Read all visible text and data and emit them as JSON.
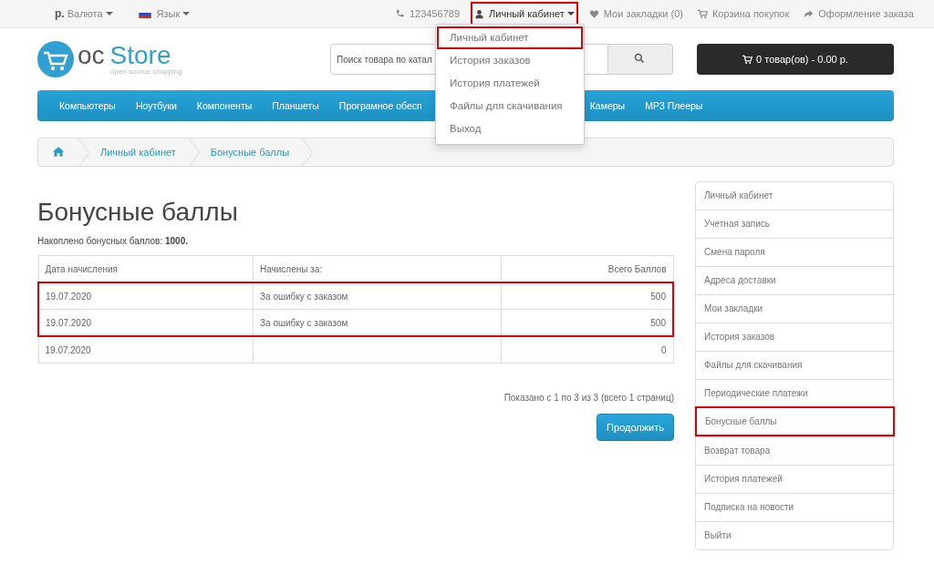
{
  "top_bar": {
    "currency": {
      "symbol": "р.",
      "label": "Валюта"
    },
    "language": {
      "label": "Язык"
    },
    "phone": "123456789",
    "links": [
      {
        "kind": "account",
        "label": "Личный кабинет",
        "highlighted": true
      },
      {
        "kind": "wishlist",
        "label": "Мои закладки (0)",
        "highlighted": false
      },
      {
        "kind": "cart",
        "label": "Корзина покупок",
        "highlighted": false
      },
      {
        "kind": "checkout",
        "label": "Оформление заказа",
        "highlighted": false
      }
    ]
  },
  "account_menu": {
    "items": [
      {
        "label": "Личный кабинет",
        "highlighted": true
      },
      {
        "label": "История заказов",
        "highlighted": false
      },
      {
        "label": "История платежей",
        "highlighted": false
      },
      {
        "label": "Файлы для скачивания",
        "highlighted": false
      },
      {
        "label": "Выход",
        "highlighted": false
      }
    ]
  },
  "logo": {
    "brand_1": "oc",
    "brand_2": "Store",
    "tagline": "open source shopping"
  },
  "search": {
    "placeholder": "Поиск товара по катал"
  },
  "cart_button": "0 товар(ов) - 0.00 р.",
  "nav": [
    "Компьютеры",
    "Ноутбуки",
    "Компоненты",
    "Планшеты",
    "Програмное обесп",
    "Камеры",
    "MP3 Плееры"
  ],
  "breadcrumb": [
    "Личный кабинет",
    "Бонусные баллы"
  ],
  "page_title": "Бонусные баллы",
  "total": "Накоплено бонусных баллов: **1000.**",
  "table": {
    "columns": [
      "Дата начисления",
      "Начислены за:",
      "Всего Баллов"
    ],
    "rows": [
      {
        "cells": [
          "19.07.2020",
          "За ошибку с заказом",
          "500"
        ],
        "highlighted": true
      },
      {
        "cells": [
          "19.07.2020",
          "За ошибку с заказом",
          "500"
        ],
        "highlighted": true
      },
      {
        "cells": [
          "19.07.2020",
          "",
          "0"
        ],
        "highlighted": false
      }
    ]
  },
  "pagination_text": "Показано с 1 по 3 из 3 (всего 1 страниц)",
  "continue_button": "Продолжить",
  "sidebar": {
    "items": [
      {
        "label": "Личный кабинет",
        "highlighted": false
      },
      {
        "label": "Учетная запись",
        "highlighted": false
      },
      {
        "label": "Смена пароля",
        "highlighted": false
      },
      {
        "label": "Адреса доставки",
        "highlighted": false
      },
      {
        "label": "Мои закладки",
        "highlighted": false
      },
      {
        "label": "История заказов",
        "highlighted": false
      },
      {
        "label": "Файлы для скачивания",
        "highlighted": false
      },
      {
        "label": "Периодические платежи",
        "highlighted": false
      },
      {
        "label": "Бонусные баллы",
        "highlighted": true
      },
      {
        "label": "Возврат товара",
        "highlighted": false
      },
      {
        "label": "История платежей",
        "highlighted": false
      },
      {
        "label": "Подписка на новости",
        "highlighted": false
      },
      {
        "label": "Выйти",
        "highlighted": false
      }
    ]
  }
}
